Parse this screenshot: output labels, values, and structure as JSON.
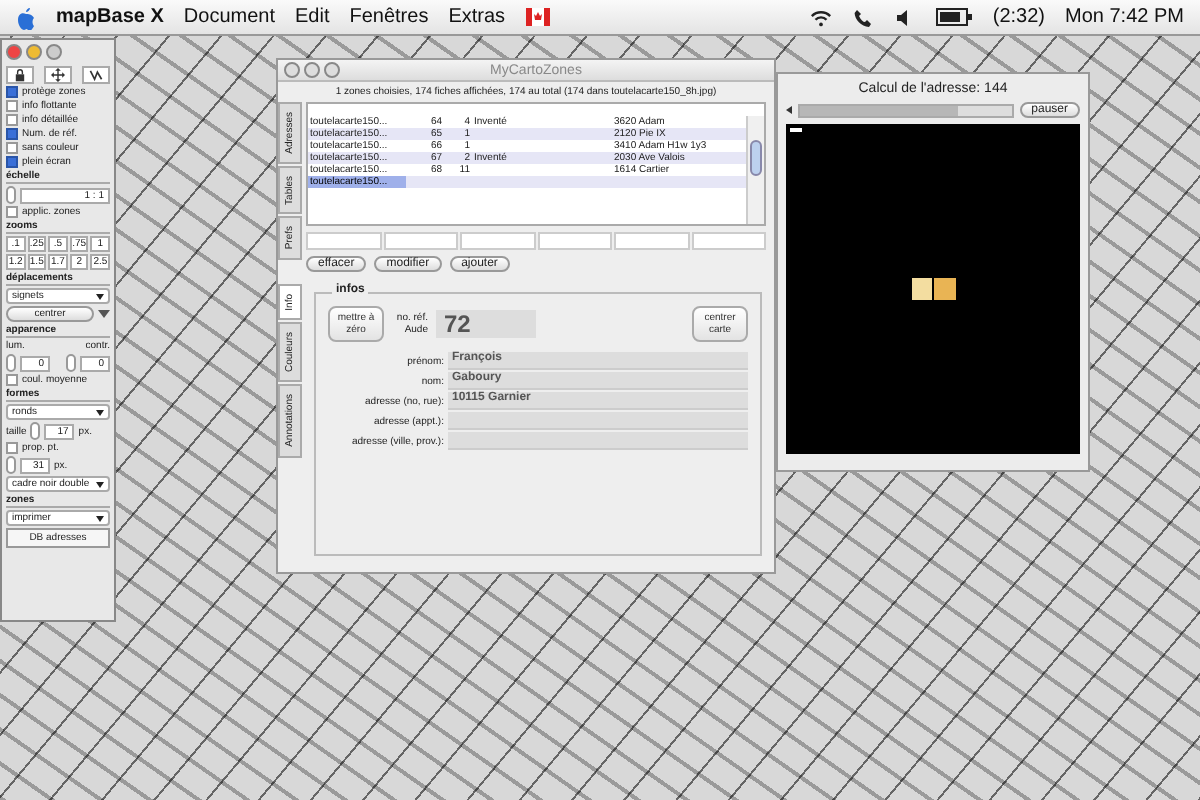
{
  "menu_bar": {
    "app": "mapBase X",
    "items": [
      "Document",
      "Edit",
      "Fenêtres",
      "Extras"
    ],
    "battery_time": "(2:32)",
    "clock": "Mon 7:42 PM"
  },
  "palette": {
    "checkboxes": [
      {
        "label": "protège zones",
        "checked": true
      },
      {
        "label": "info flottante",
        "checked": false
      },
      {
        "label": "info détaillée",
        "checked": false
      },
      {
        "label": "Num. de réf.",
        "checked": true
      },
      {
        "label": "sans couleur",
        "checked": false
      },
      {
        "label": "plein écran",
        "checked": true
      }
    ],
    "scale_label": "échelle",
    "scale_value": "1 : 1",
    "apply_zones": {
      "label": "applic. zones",
      "checked": false
    },
    "zooms_label": "zooms",
    "zooms": [
      ".1",
      ".25",
      ".5",
      ".75",
      "1",
      "1.2",
      "1.5",
      "1.7",
      "2",
      "2.5"
    ],
    "moves_label": "déplacements",
    "bookmarks": "signets",
    "center": "centrer",
    "appearance_label": "apparence",
    "lum_label": "lum.",
    "contr_label": "contr.",
    "lum": "0",
    "contr": "0",
    "avg_color": {
      "label": "coul. moyenne",
      "checked": false
    },
    "shapes_label": "formes",
    "shape": "ronds",
    "size_label": "taille",
    "size": "17",
    "size_unit": "px.",
    "prop": {
      "label": "prop. pt.",
      "checked": false
    },
    "size2": "31",
    "size2_unit": "px.",
    "frame": "cadre noir double",
    "zones_label": "zones",
    "print": "imprimer",
    "db_button": "DB adresses"
  },
  "main_window": {
    "title": "MyCartoZones",
    "status": "1 zones choisies, 174 fiches affichées, 174 au total (174 dans toutelacarte150_8h.jpg)",
    "tabs": [
      {
        "label": "Adresses",
        "selected": false
      },
      {
        "label": "Tables",
        "selected": false
      },
      {
        "label": "Prefs",
        "selected": false
      }
    ],
    "rows": [
      {
        "file": "toutelacarte150...",
        "ref": "64",
        "count": "4",
        "note": "Inventé",
        "address": "3620 Adam",
        "selected": false
      },
      {
        "file": "toutelacarte150...",
        "ref": "65",
        "count": "1",
        "address": "2120 Pie IX",
        "selected": false
      },
      {
        "file": "toutelacarte150...",
        "ref": "66",
        "count": "1",
        "address": "3410 Adam H1w 1y3",
        "selected": false
      },
      {
        "file": "toutelacarte150...",
        "ref": "67",
        "count": "2",
        "note": "Inventé",
        "address": "2030 Ave Valois",
        "selected": false
      },
      {
        "file": "toutelacarte150...",
        "ref": "68",
        "count": "11",
        "address": "1614 Cartier",
        "selected": false
      },
      {
        "file": "toutelacarte150...",
        "selected": true
      }
    ],
    "buttons": [
      "effacer",
      "modifier",
      "ajouter"
    ],
    "lower_tabs": [
      {
        "label": "Info",
        "selected": true
      },
      {
        "label": "Couleurs",
        "selected": false
      },
      {
        "label": "Annotations",
        "selected": false
      }
    ],
    "infos": {
      "title": "infos",
      "reset": "mettre à zéro",
      "ref_label": "no. réf. Aude",
      "ref": "72",
      "center_button": "centrer carte",
      "fields": [
        {
          "label": "prénom:",
          "value": "François"
        },
        {
          "label": "nom:",
          "value": "Gaboury"
        },
        {
          "label": "adresse (no, rue):",
          "value": "10115 Garnier"
        },
        {
          "label": "adresse (appt.):"
        },
        {
          "label": "adresse (ville, prov.):"
        }
      ]
    }
  },
  "progress_window": {
    "title": "Calcul de l'adresse: 144",
    "progress": {
      "level": 0.75
    },
    "pause": "pauser"
  }
}
